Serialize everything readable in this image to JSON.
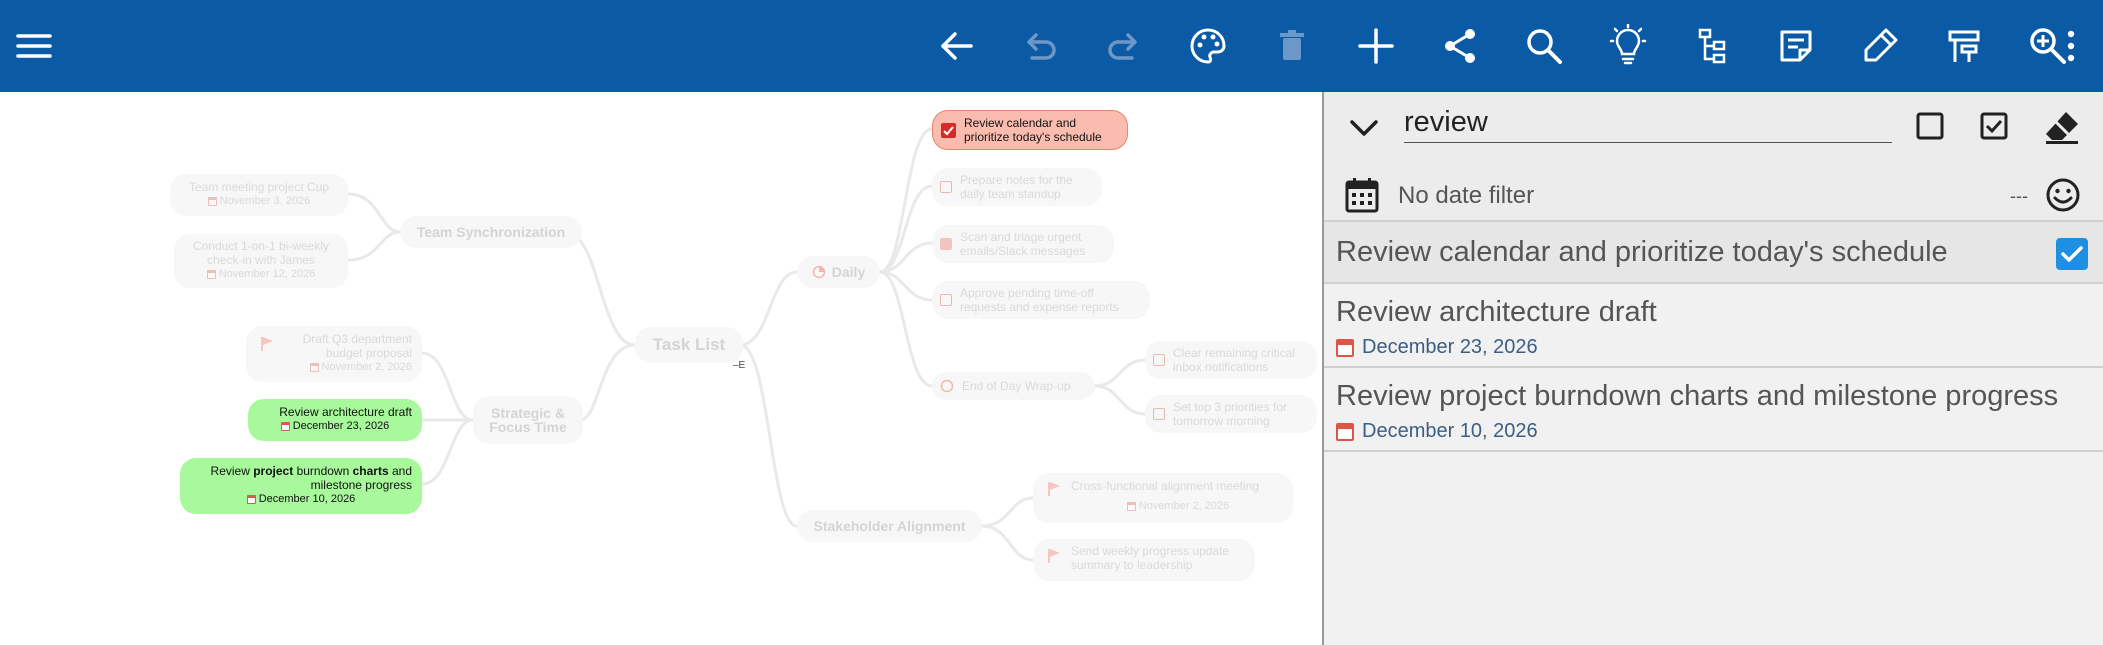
{
  "toolbar": {
    "bg": "#0a5aa5",
    "icons": [
      "menu-icon",
      "back-icon",
      "undo-icon",
      "redo-icon",
      "palette-icon",
      "trash-icon",
      "add-icon",
      "share-icon",
      "search-icon",
      "lightbulb-icon",
      "tree-icon",
      "note-icon",
      "pen-icon",
      "layout-icon",
      "zoom-icon",
      "more-icon"
    ]
  },
  "mindmap": {
    "root": "Task List",
    "collapse_marker": "–E",
    "branches": {
      "team": "Team Synchronization",
      "strategic": "Strategic & Focus Time",
      "daily": "Daily",
      "stakeholder": "Stakeholder Alignment",
      "eod": "End of Day Wrap-up"
    },
    "nodes": {
      "team_meeting": {
        "text": "Team meeting project Cup",
        "date": "November 3, 2026"
      },
      "one_on_one": {
        "text": "Conduct 1-on-1 bi-weekly check-in with James",
        "date": "November 12, 2026"
      },
      "draft_q3": {
        "text": "Draft Q3 department budget proposal",
        "date": "November 2, 2026"
      },
      "review_arch": {
        "text": "Review architecture draft",
        "date": "December 23, 2026"
      },
      "review_burndown": {
        "pre": "Review ",
        "b1": "project",
        "mid": " burndown ",
        "b2": "charts",
        "post": " and milestone progress",
        "date": "December 10, 2026"
      },
      "review_calendar": {
        "text": "Review calendar and prioritize today's schedule"
      },
      "prepare_notes": {
        "text": "Prepare notes for the daily team standup"
      },
      "scan_emails": {
        "text": "Scan and triage urgent emails/Slack messages"
      },
      "approve_timeoff": {
        "text": "Approve pending time-off requests and expense reports"
      },
      "clear_inbox": {
        "text": "Clear remaining critical inbox notifications"
      },
      "set_priorities": {
        "text": "Set top 3 priorities for tomorrow morning"
      },
      "cross_functional": {
        "text": "Cross-functional alignment meeting",
        "date": "November 2, 2026"
      },
      "weekly_update": {
        "text": "Send weekly progress update summary to leadership"
      }
    }
  },
  "search_panel": {
    "query": "review",
    "date_filter": "No date filter",
    "date_dash": "---",
    "results": [
      {
        "title": "Review calendar and prioritize today's schedule",
        "checked": true
      },
      {
        "title": "Review architecture draft",
        "date": "December 23, 2026"
      },
      {
        "title": "Review project burndown charts and milestone progress",
        "date": "December 10, 2026"
      }
    ]
  }
}
